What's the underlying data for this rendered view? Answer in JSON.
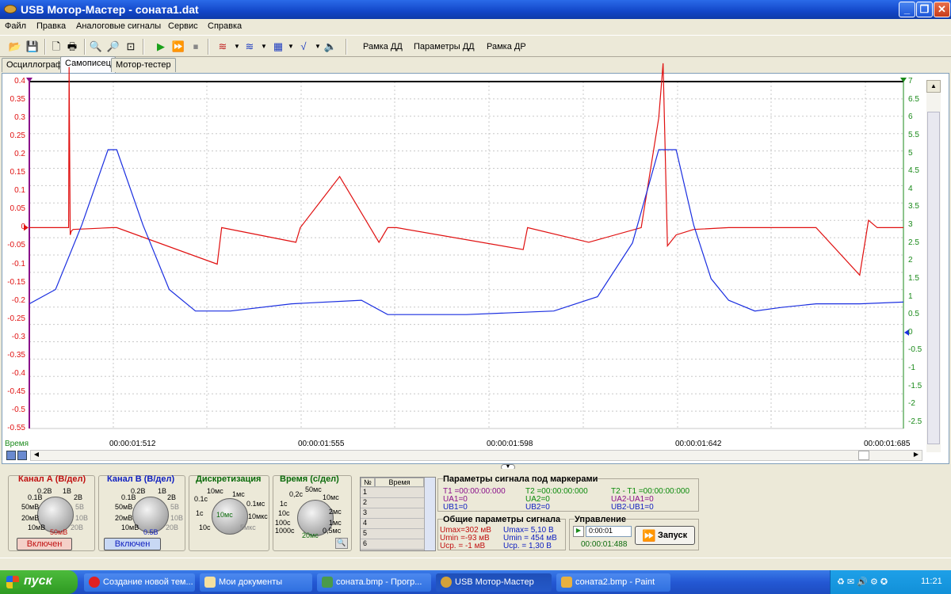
{
  "window": {
    "title": "USB Мотор-Мастер - соната1.dat"
  },
  "menu": [
    "Файл",
    "Правка",
    "Аналоговые сигналы",
    "Сервис",
    "Справка"
  ],
  "toolbar": {
    "ramka_dd": "Рамка ДД",
    "params_dd": "Параметры ДД",
    "ramka_dr": "Рамка ДР"
  },
  "tabs": [
    "Осциллограф",
    "Самописец",
    "Мотор-тестер"
  ],
  "axes": {
    "x_label": "Время",
    "x_ticks": [
      "00:00:01:512",
      "00:00:01:555",
      "00:00:01:598",
      "00:00:01:642",
      "00:00:01:685"
    ],
    "left_ticks": [
      "0.4",
      "0.35",
      "0.3",
      "0.25",
      "0.2",
      "0.15",
      "0.1",
      "0.05",
      "0",
      "-0.05",
      "-0.1",
      "-0.15",
      "-0.2",
      "-0.25",
      "-0.3",
      "-0.35",
      "-0.4",
      "-0.45",
      "-0.5",
      "-0.55"
    ],
    "right_ticks": [
      "7",
      "6.5",
      "6",
      "5.5",
      "5",
      "4.5",
      "4",
      "3.5",
      "3",
      "2.5",
      "2",
      "1.5",
      "1",
      "0.5",
      "0",
      "-0.5",
      "-1",
      "-1.5",
      "-2",
      "-2.5"
    ]
  },
  "colors": {
    "chA": "#e01010",
    "chB": "#1a2ee0",
    "right": "#1a8a1a"
  },
  "chart_data": {
    "type": "line",
    "xlabel": "Время",
    "ylim": [
      -0.55,
      0.4
    ],
    "y2lim": [
      -2.5,
      7
    ],
    "series": [
      {
        "axis": "left",
        "x": [
          0,
          0.045,
          0.0455,
          0.0468,
          0.048,
          0.05,
          0.095,
          0.1,
          0.215,
          0.22,
          0.305,
          0.31,
          0.355,
          0.4,
          0.41,
          0.42,
          0.565,
          0.57,
          0.64,
          0.7,
          0.72,
          0.725,
          0.73,
          0.74,
          0.76,
          0.8,
          0.85,
          0.9,
          0.95,
          0.96,
          0.97,
          0.98,
          1.0
        ],
        "y": [
          0,
          0,
          0.44,
          -0.02,
          -0.01,
          -0.005,
          0,
          0,
          -0.1,
          0,
          -0.04,
          0,
          0.14,
          -0.04,
          0,
          0,
          -0.06,
          0,
          -0.04,
          0,
          0.3,
          0.45,
          -0.05,
          -0.02,
          -0.005,
          0,
          0,
          0,
          -0.13,
          0.02,
          0,
          0,
          0
        ]
      },
      {
        "axis": "right",
        "x": [
          0,
          0.03,
          0.06,
          0.09,
          0.1,
          0.13,
          0.16,
          0.19,
          0.23,
          0.3,
          0.38,
          0.41,
          0.43,
          0.5,
          0.6,
          0.65,
          0.69,
          0.72,
          0.74,
          0.76,
          0.78,
          0.8,
          0.83,
          0.86,
          0.9,
          0.95,
          1.0
        ],
        "y": [
          0.8,
          1.2,
          3,
          5.1,
          5.1,
          3,
          1.2,
          0.6,
          0.6,
          0.8,
          0.9,
          0.5,
          0.5,
          0.5,
          0.6,
          1,
          2.5,
          5.1,
          5.1,
          3,
          1.5,
          0.9,
          0.6,
          0.7,
          0.8,
          0.8,
          0.85
        ]
      }
    ]
  },
  "panels": {
    "chA": {
      "title": "Канал А (В/дел)",
      "labels": [
        "0.2В",
        "1В",
        "0.1В",
        "2В",
        "50мВ",
        "5В",
        "20мВ",
        "10В",
        "10мВ",
        "20В",
        "50мВ"
      ],
      "button": "Включен"
    },
    "chB": {
      "title": "Канал В (В/дел)",
      "labels": [
        "0.2В",
        "1В",
        "0.1В",
        "2В",
        "50мВ",
        "5В",
        "20мВ",
        "10В",
        "10мВ",
        "20В",
        "0.5В"
      ],
      "button": "Включен"
    },
    "disc": {
      "title": "Дискретизация",
      "labels": [
        "10мс",
        "1мс",
        "0.1с",
        "0.1мс",
        "1с",
        "10мкс",
        "10с",
        "5мкс",
        "10мс"
      ]
    },
    "time": {
      "title": "Время (с/дел)",
      "labels": [
        "50мс",
        "0,2с",
        "10мс",
        "1с",
        "2мс",
        "10с",
        "1мс",
        "100с",
        "1000с",
        "0,5мс",
        "20мс"
      ]
    },
    "markers_table": {
      "col1": "№",
      "col2": "Время",
      "rows": [
        "1",
        "2",
        "3",
        "4",
        "5",
        "6"
      ]
    },
    "marker_params": {
      "title": "Параметры сигнала под маркерами",
      "t1": "T1 =00:00:00:000",
      "t2": "T2 =00:00:00:000",
      "dt": "T2 - T1 =00:00:00:000",
      "ua1": "UA1=0",
      "ua2": "UA2=0",
      "dua": "UA2-UA1=0",
      "ub1": "UB1=0",
      "ub2": "UB2=0",
      "dub": "UB2-UB1=0"
    },
    "general": {
      "title": "Общие параметры сигнала",
      "a_max": "Umax=302 мВ",
      "a_min": "Umin =-93 мВ",
      "a_avg": "Uср. = -1 мВ",
      "b_max": "Umax= 5,10 В",
      "b_min": "Umin = 454 мВ",
      "b_avg": "Uср. = 1,30 В"
    },
    "control": {
      "title": "Управление",
      "value": "0:00:01",
      "elapsed": "00:00:01:488",
      "start": "Запуск"
    }
  },
  "taskbar": {
    "start": "пуск",
    "tasks": [
      "Создание новой тем...",
      "Мои документы",
      "соната.bmp - Прогр...",
      "USB Мотор-Мастер",
      "соната2.bmp - Paint"
    ],
    "clock": "11:21"
  }
}
